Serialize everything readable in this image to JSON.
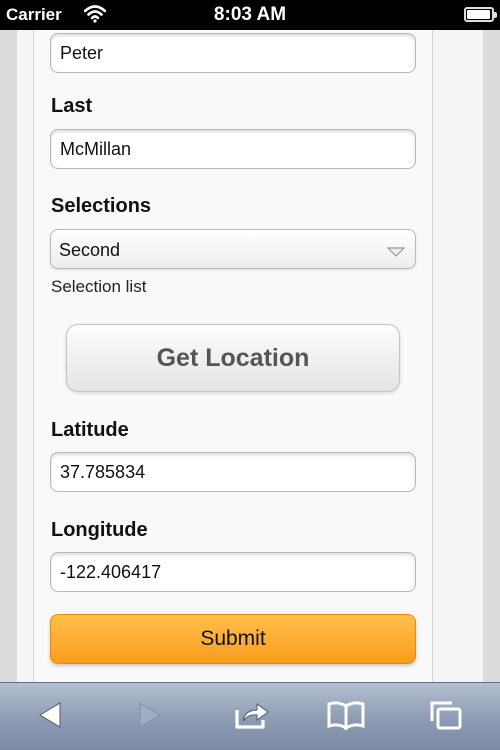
{
  "status_bar": {
    "carrier": "Carrier",
    "time": "8:03 AM",
    "battery_level": 0.95
  },
  "form": {
    "first_value": "Peter",
    "last_label": "Last",
    "last_value": "McMillan",
    "selections_label": "Selections",
    "selections_value": "Second",
    "selections_hint": "Selection list",
    "get_location_label": "Get Location",
    "latitude_label": "Latitude",
    "latitude_value": "37.785834",
    "longitude_label": "Longitude",
    "longitude_value": "-122.406417",
    "submit_label": "Submit"
  },
  "toolbar": {
    "icons": [
      "back-icon",
      "forward-icon",
      "share-icon",
      "bookmarks-icon",
      "tabs-icon"
    ]
  },
  "colors": {
    "submit_accent": "#fa9d1d",
    "toolbar": "#8d9bb3"
  }
}
